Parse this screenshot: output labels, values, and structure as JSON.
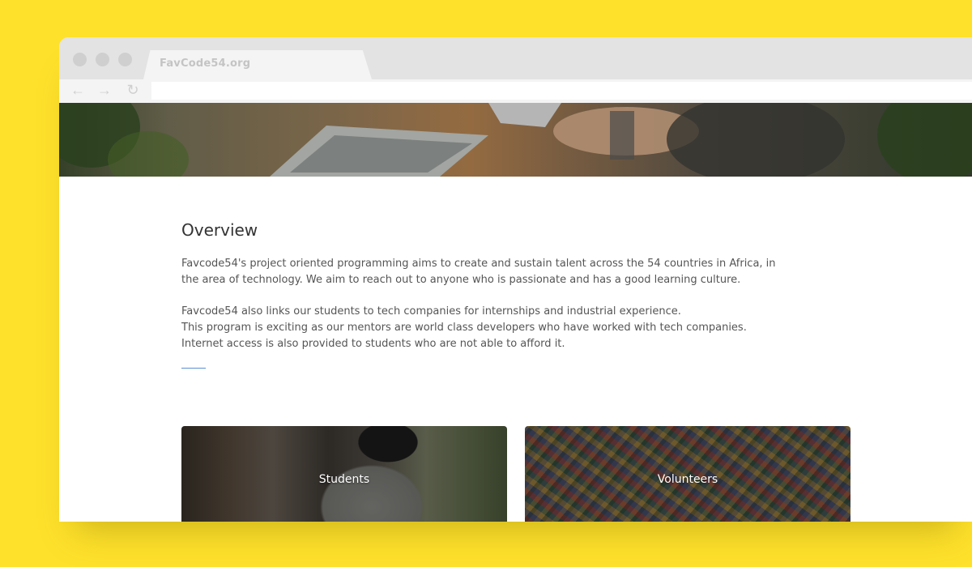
{
  "browser": {
    "tab_title": "FavCode54.org",
    "back_icon": "←",
    "forward_icon": "→",
    "reload_icon": "↻"
  },
  "overview": {
    "heading": "Overview",
    "para1": [
      "Favcode54's project oriented programming aims to create and sustain talent across the 54 countries in Africa, in",
      "the area of technology. We aim to reach out to anyone who is passionate and has a good learning culture."
    ],
    "para2": [
      "Favcode54 also links our students to tech companies for internships and industrial experience.",
      "This program is exciting as our mentors are world class developers who have worked with tech companies.",
      "Internet access is also provided to students who are not able to afford it."
    ]
  },
  "cards": {
    "students": "Students",
    "volunteers": "Volunteers"
  },
  "colors": {
    "background": "#FEE12B",
    "accent_divider": "#5b8fd6"
  }
}
